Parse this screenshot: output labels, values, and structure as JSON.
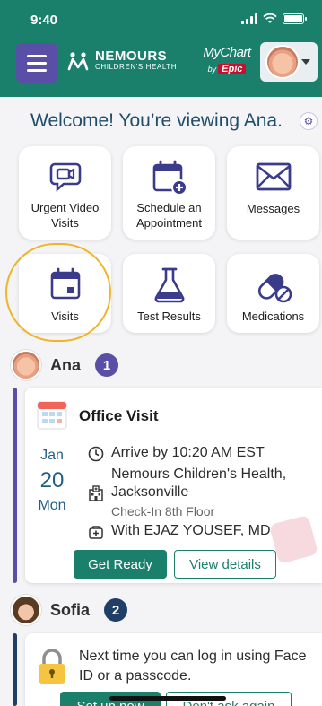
{
  "status_bar": {
    "time": "9:40"
  },
  "header": {
    "brand_name": "NEMOURS",
    "brand_sub": "CHILDREN'S HEALTH",
    "mychart": "MyChart",
    "by": "by",
    "epic": "Epic",
    "colors": {
      "header_bg": "#1a7f6b",
      "menu_bg": "#5a4fa6",
      "epic_red": "#c8102e"
    }
  },
  "welcome": {
    "text": "Welcome! You’re viewing Ana."
  },
  "tiles": [
    {
      "label": "Urgent Video Visits",
      "icon": "video-chat-icon"
    },
    {
      "label": "Schedule an Appointment",
      "icon": "calendar-add-icon"
    },
    {
      "label": "Messages",
      "icon": "envelope-icon"
    },
    {
      "label": "Visits",
      "icon": "calendar-icon",
      "highlighted": true
    },
    {
      "label": "Test Results",
      "icon": "flask-icon"
    },
    {
      "label": "Medications",
      "icon": "pill-icon"
    }
  ],
  "patients": [
    {
      "name": "Ana",
      "badge": "1",
      "badge_color": "#5a4fa6",
      "card": {
        "title": "Office Visit",
        "month": "Jan",
        "day": "20",
        "weekday": "Mon",
        "arrive": "Arrive by 10:20 AM EST",
        "location_line1": "Nemours Children's Health,",
        "location_line2": "Jacksonville",
        "checkin": "Check-In 8th Floor",
        "provider": "With EJAZ YOUSEF, MD",
        "primary_btn": "Get Ready",
        "secondary_btn": "View details"
      }
    },
    {
      "name": "Sofia",
      "badge": "2",
      "badge_color": "#1f3f66",
      "card": {
        "message": "Next time you can log in using Face ID or a passcode.",
        "primary_btn": "Set up now",
        "secondary_btn": "Don't ask again"
      }
    }
  ]
}
